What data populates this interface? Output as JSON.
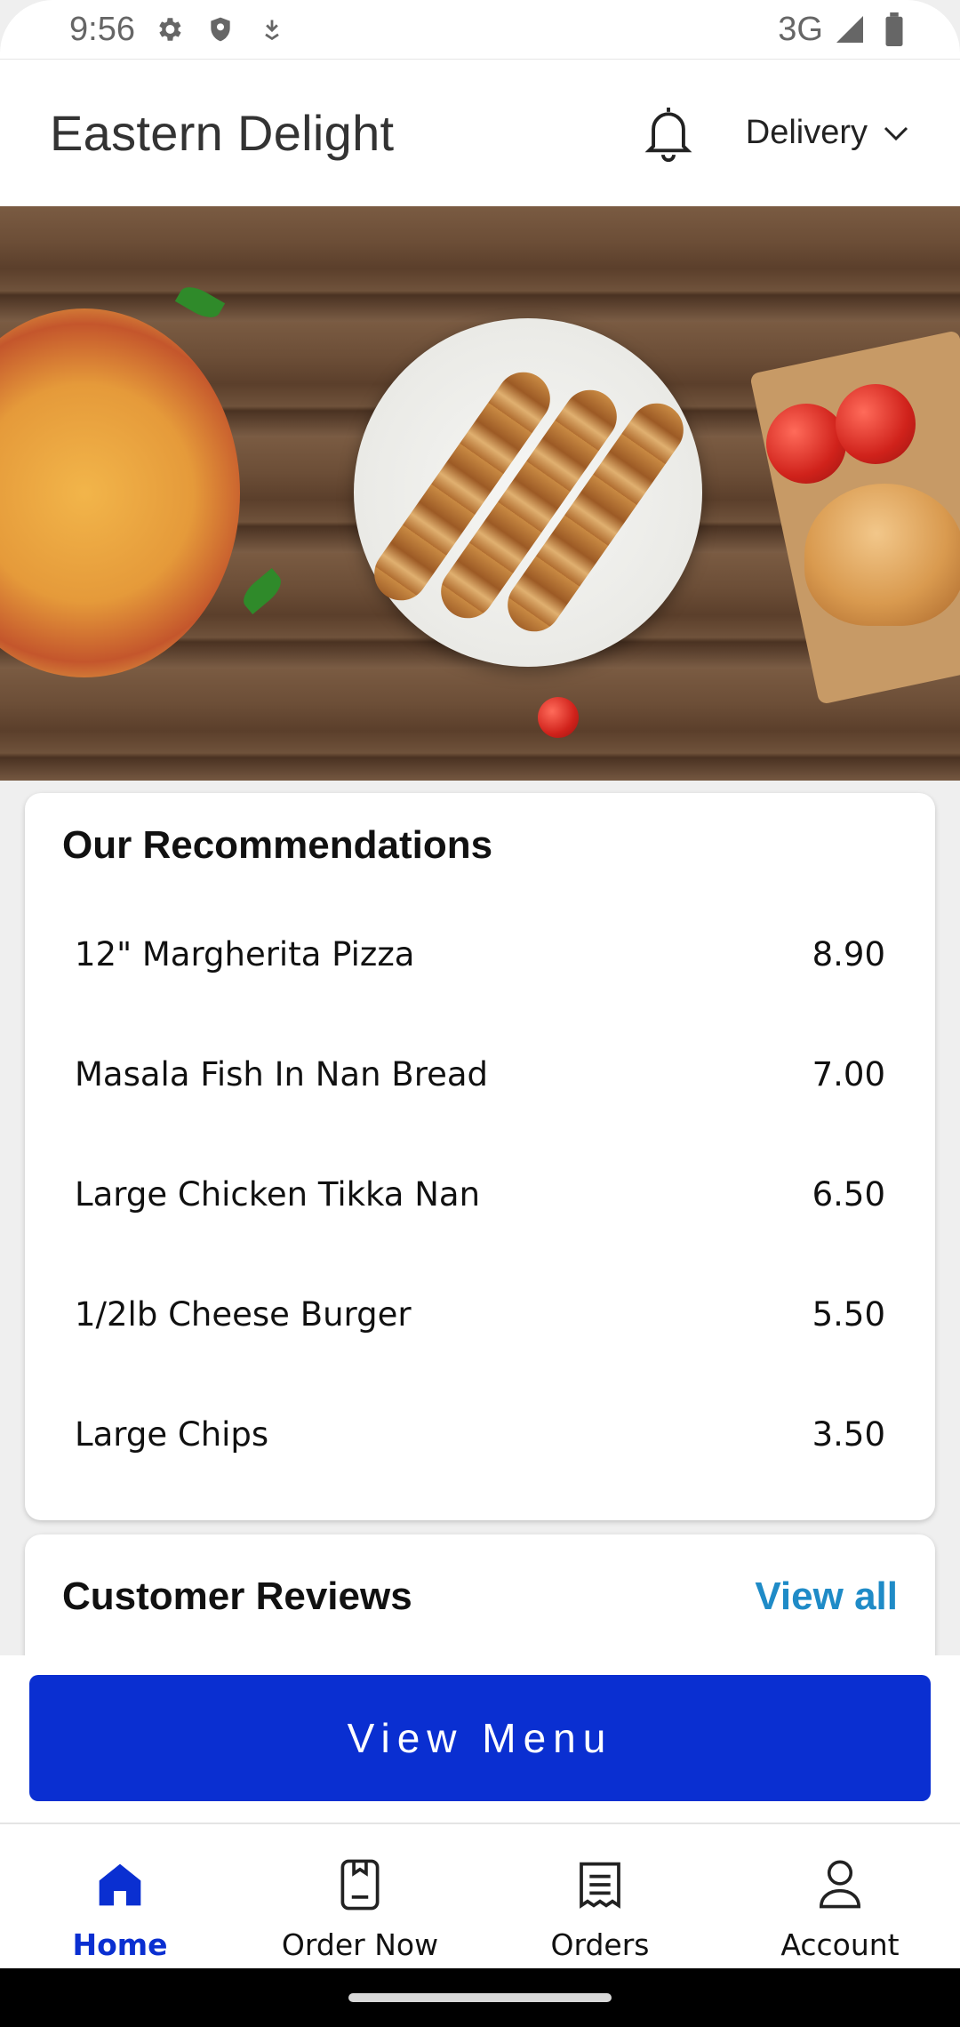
{
  "status_bar": {
    "time": "9:56",
    "network": "3G",
    "icons": [
      "gear-icon",
      "shield-icon",
      "download-icon",
      "signal-icon",
      "battery-icon"
    ]
  },
  "header": {
    "title": "Eastern Delight",
    "bell_icon": "bell-icon",
    "delivery_mode": "Delivery"
  },
  "hero": {
    "image_alt": ""
  },
  "recommendations": {
    "title": "Our Recommendations",
    "items": [
      {
        "name": "12\" Margherita Pizza",
        "price": "8.90"
      },
      {
        "name": "Masala Fish In Nan Bread",
        "price": "7.00"
      },
      {
        "name": "Large Chicken Tikka Nan",
        "price": "6.50"
      },
      {
        "name": "1/2lb Cheese Burger",
        "price": "5.50"
      },
      {
        "name": "Large Chips",
        "price": "3.50"
      }
    ]
  },
  "reviews": {
    "title": "Customer Reviews",
    "view_all": "View all"
  },
  "cta": {
    "label": "View Menu"
  },
  "bottom_nav": {
    "items": [
      {
        "label": "Home",
        "icon": "home-icon",
        "active": true
      },
      {
        "label": "Order Now",
        "icon": "order-now-icon",
        "active": false
      },
      {
        "label": "Orders",
        "icon": "receipt-icon",
        "active": false
      },
      {
        "label": "Account",
        "icon": "account-icon",
        "active": false
      }
    ]
  },
  "colors": {
    "accent": "#0a2fd1",
    "link": "#1f8bc7"
  }
}
